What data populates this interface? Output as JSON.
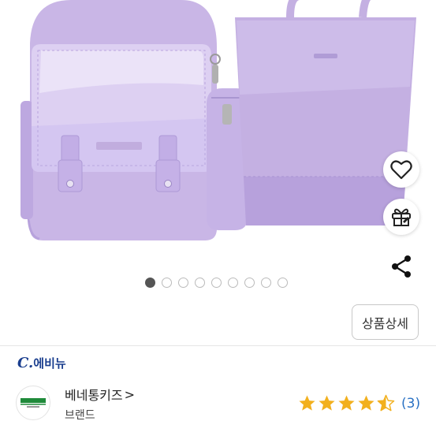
{
  "gallery": {
    "dot_count": 9,
    "active_index": 0,
    "colors": {
      "bag": "#c9b6e6",
      "bag_dark": "#a996d1",
      "bag_light": "#ddd0f2",
      "tote": "#c4b0e2"
    }
  },
  "actions": {
    "heart_icon": "heart-icon",
    "gift_icon": "gift-icon",
    "share_icon": "share-icon",
    "detail_label": "상품상세"
  },
  "brand": {
    "logo_prefix": "C.",
    "logo_name": "에비뉴",
    "name": "베네통키즈",
    "name_chevron": ">",
    "subtitle": "브랜드"
  },
  "rating": {
    "value": 4.5,
    "max": 5,
    "review_count": "(3)",
    "star_color": "#f2b01e"
  }
}
